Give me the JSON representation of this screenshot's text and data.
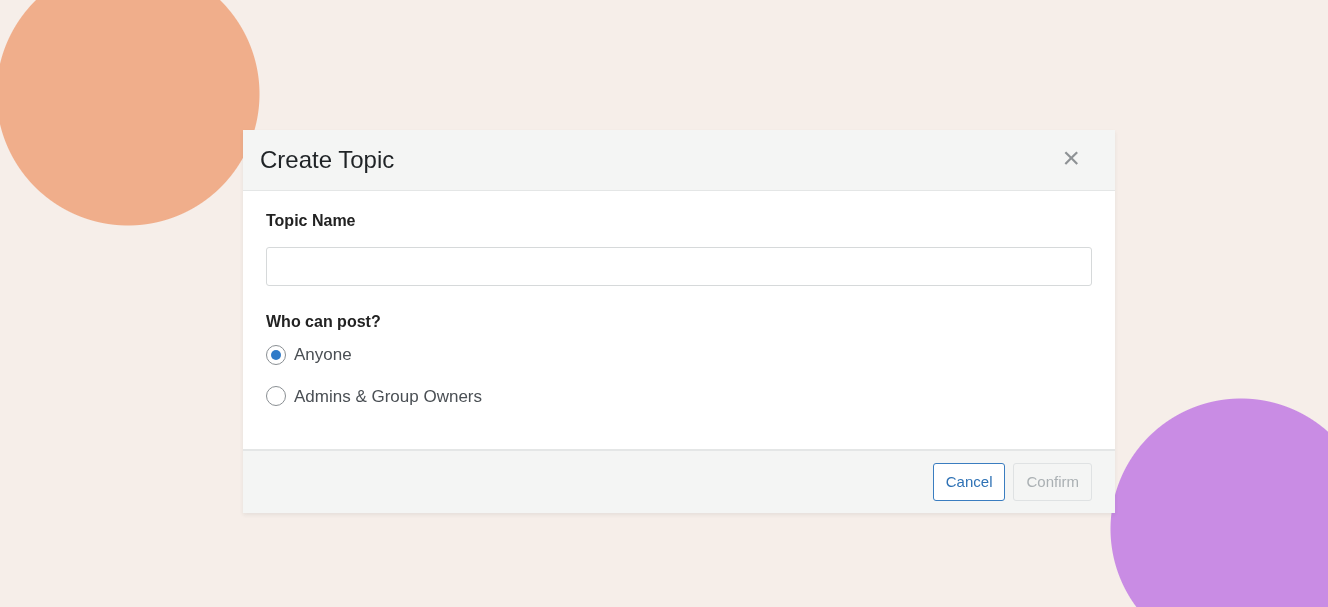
{
  "dialog": {
    "title": "Create Topic",
    "close": "×",
    "fields": [
      {
        "label": "Topic Name"
      }
    ],
    "question": "Who can post?",
    "options": [
      {
        "label": "Anyone",
        "selected": true
      },
      {
        "label": "Admins & Group Owners",
        "selected": false
      }
    ],
    "buttons": [
      {
        "label": "Cancel",
        "disabled": false
      },
      {
        "label": "Confirm",
        "disabled": true
      }
    ]
  }
}
